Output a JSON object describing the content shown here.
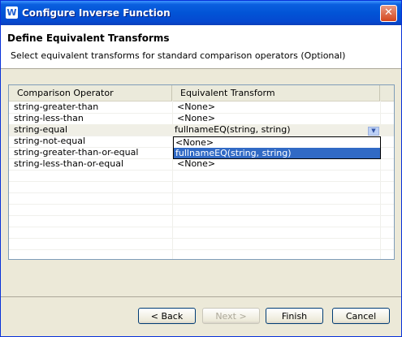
{
  "window": {
    "title": "Configure Inverse Function"
  },
  "header": {
    "title": "Define Equivalent Transforms",
    "subtitle": "Select equivalent transforms for standard comparison operators (Optional)"
  },
  "table": {
    "columns": [
      "Comparison Operator",
      "Equivalent Transform"
    ],
    "rows": [
      {
        "operator": "string-greater-than",
        "transform": "<None>"
      },
      {
        "operator": "string-less-than",
        "transform": "<None>"
      },
      {
        "operator": "string-equal",
        "transform": "fullnameEQ(string, string)"
      },
      {
        "operator": "string-not-equal",
        "transform": ""
      },
      {
        "operator": "string-greater-than-or-equal",
        "transform": ""
      },
      {
        "operator": "string-less-than-or-equal",
        "transform": "<None>"
      }
    ]
  },
  "dropdown": {
    "options": [
      "<None>",
      "fullnameEQ(string, string)"
    ],
    "selected_index": 1
  },
  "buttons": {
    "back": "< Back",
    "next": "Next >",
    "finish": "Finish",
    "cancel": "Cancel"
  }
}
